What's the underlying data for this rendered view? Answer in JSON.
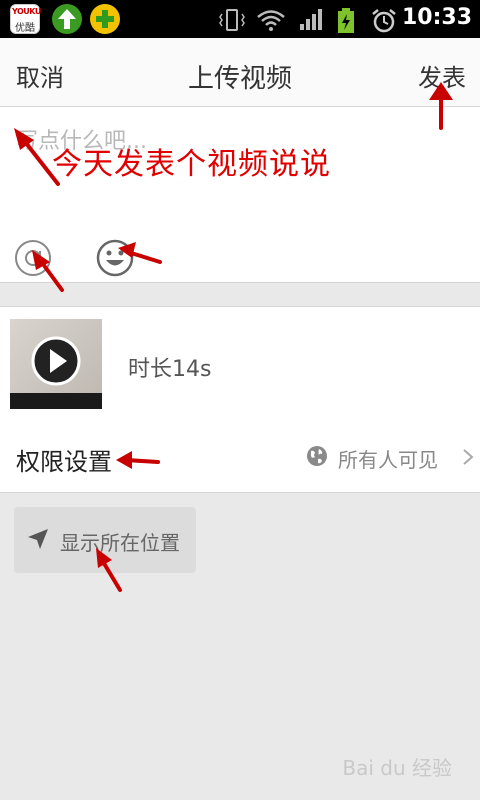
{
  "status_bar": {
    "time": "10:33",
    "app_icons": [
      "youku-icon",
      "upload-app-icon",
      "plus-app-icon"
    ],
    "youku_logo_text": "YOUKU",
    "youku_logo_sub": "优酷"
  },
  "header": {
    "cancel_label": "取消",
    "title": "上传视频",
    "publish_label": "发表"
  },
  "compose": {
    "placeholder": "写点什么吧...",
    "overlay_annotation": "今天发表个视频说说",
    "mention_icon": "at-icon",
    "emoji_icon": "emoji-icon"
  },
  "video": {
    "duration_label": "时长14s"
  },
  "permission": {
    "label": "权限设置",
    "value": "所有人可见"
  },
  "location": {
    "label": "显示所在位置"
  },
  "watermark": "Bai du 经验",
  "colors": {
    "annotation": "#c80000",
    "status_bar": "#000000",
    "background": "#e9e9e9"
  }
}
